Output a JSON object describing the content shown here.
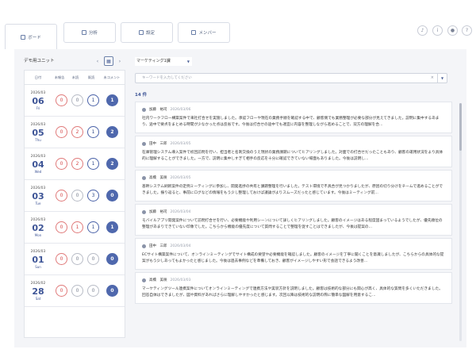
{
  "tabs": [
    {
      "label": "ボード",
      "icon": "board-icon",
      "active": true
    },
    {
      "label": "分析",
      "icon": "chart-icon",
      "active": false
    },
    {
      "label": "設定",
      "icon": "settings-icon",
      "active": false
    },
    {
      "label": "メンバー",
      "icon": "members-icon",
      "active": false
    }
  ],
  "header_icons": [
    "bell-icon",
    "info-icon",
    "user-icon",
    "help-icon"
  ],
  "unit": {
    "name": "デモ用ユニット",
    "prev": "‹",
    "next": "›"
  },
  "calendar": {
    "headers": [
      "日付",
      "未報告",
      "未読",
      "既読",
      "未コメント"
    ],
    "rows": [
      {
        "ym": "2026/03",
        "day": "06",
        "wd": "Fri",
        "unreported": "0",
        "unread": "0",
        "read": "1",
        "uncommented": "1"
      },
      {
        "ym": "2026/03",
        "day": "05",
        "wd": "Thu",
        "unreported": "0",
        "unread": "2",
        "read": "1",
        "uncommented": "2"
      },
      {
        "ym": "2026/03",
        "day": "04",
        "wd": "Wed",
        "unreported": "0",
        "unread": "2",
        "read": "1",
        "uncommented": "2"
      },
      {
        "ym": "2026/03",
        "day": "03",
        "wd": "Tue",
        "unreported": "0",
        "unread": "0",
        "read": "3",
        "uncommented": "0"
      },
      {
        "ym": "2026/03",
        "day": "02",
        "wd": "Mon",
        "unreported": "0",
        "unread": "1",
        "read": "1",
        "uncommented": "1"
      },
      {
        "ym": "2026/03",
        "day": "01",
        "wd": "Sun",
        "unreported": "0",
        "unread": "0",
        "read": "0",
        "uncommented": "0"
      },
      {
        "ym": "2026/02",
        "day": "28",
        "wd": "Sat",
        "unreported": "0",
        "unread": "0",
        "read": "0",
        "uncommented": "0"
      }
    ]
  },
  "filter": {
    "department": "マーケティング1課"
  },
  "search": {
    "placeholder": "キーワードを入力してください",
    "clear": "×"
  },
  "count": "14 件",
  "reports": [
    {
      "name": "加藤　裕司",
      "date": "2026/03/06",
      "text": "社内ワークフロー構築案件で来社打合せを実施しました。承認フローや現在の業務手順を確認する中で、顧客側でも業務整理が必要な部分が見えてきました。説明に集中するあまり、途中で要点をまとめる時間が少なかった点は反省です。今後は打合せの途中でも適宜に内容を整理しながら進めることで、双方の理解を合..."
    },
    {
      "name": "田中　三郎",
      "date": "2026/03/05",
      "text": "在庫管理システム導入案件で初回訪問を行い、担当者と名刺交換のうえ現状の業務課題についてヒアリングしました。対面での打合せだったこともあり、顧客の運用状況をより具体的に理解することができました。一方で、説明に集中しすぎて相手の反応を十分に確認できていない場面もありました。今後は説明し..."
    },
    {
      "name": "高橋　美咲",
      "date": "2026/03/05",
      "text": "基幹システム刷新案件の定例ミーティングに参加し、開発進捗の共有と課題整理を行いました。テスト環境で不具合が見つかりましたが、原因の切り分けをチームで進めることができました。振り返ると、事前にログなどの情報をもう少し整理しておけば議論がよりスムーズだったと感じています。今後はミーティング前..."
    },
    {
      "name": "加藤　裕司",
      "date": "2026/03/04",
      "text": "モバイルアプリ開発案件について訪問打合せを行い、必要機能や利用シーンについて詳しくヒアリングしました。顧客のイメージはある程度固まっているようでしたが、優先順位の整理があまりできていない印象でした。こちらから機能の優先度について質問することで整理を促すことはできましたが、今後は提案の..."
    },
    {
      "name": "田中　三郎",
      "date": "2026/03/04",
      "text": "ECサイト構築案件について、オンラインミーティングでサイト構成の要望や必要機能を確認しました。顧客のイメージを丁寧に聞くことを意識しましたが、こちらからの具体的な提案がもう少しあってもよかったと感じました。今後は過去事例などを準備しておき、顧客がイメージしやすい形で会話できるよう改善..."
    },
    {
      "name": "高橋　美咲",
      "date": "2026/03/03",
      "text": "マーケティングツール連携案件についてオンラインミーティングで連携方法や実装方針を説明しました。顧客は技術的な部分にも関心が高く、具体的な質問を多くいただきました。回答自体はできましたが、図や資料があればさらに理解しやすかったと感じます。次回以降は技術的な説明の際に簡単な図解を用意するこ..."
    }
  ]
}
